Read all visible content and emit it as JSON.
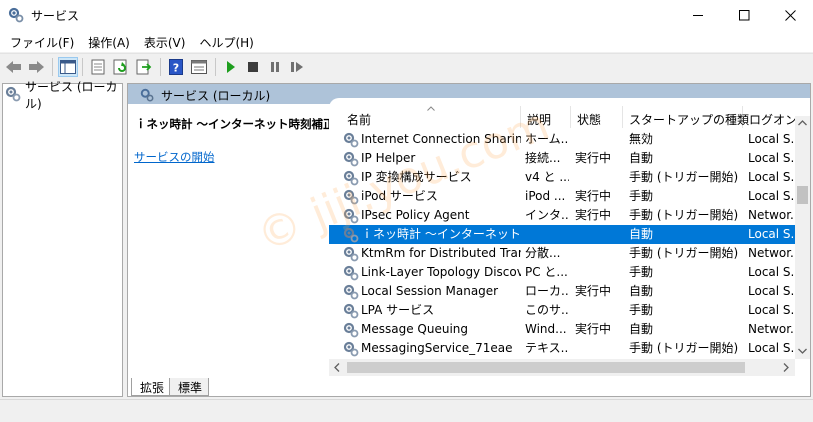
{
  "window": {
    "title": "サービス",
    "icon": "gear-icon"
  },
  "menu": {
    "items": [
      {
        "label": "ファイル(F)"
      },
      {
        "label": "操作(A)"
      },
      {
        "label": "表示(V)"
      },
      {
        "label": "ヘルプ(H)"
      }
    ]
  },
  "toolbar": {
    "icons": [
      "back-icon",
      "forward-icon",
      "console-tree-icon",
      "properties-icon",
      "refresh-icon",
      "export-icon",
      "help-icon",
      "view-icon",
      "start-service-icon",
      "stop-service-icon",
      "pause-service-icon",
      "resume-service-icon"
    ],
    "colors": {
      "start": "#1e9e1e",
      "stop": "#3c3c3c",
      "help": "#2a56c6"
    }
  },
  "tree": {
    "root_label": "サービス (ローカル)"
  },
  "right_pane": {
    "header_title": "サービス (ローカル)",
    "selected_service_name": "ｉネッ時計 ～インターネット時刻補正～",
    "start_link": "サービスの開始"
  },
  "table": {
    "columns": {
      "name": "名前",
      "description": "説明",
      "status": "状態",
      "startup": "スタートアップの種類",
      "logon": "ログオン"
    },
    "rows": [
      {
        "name": "Internet Connection Sharin...",
        "desc": "ホーム...",
        "status": "",
        "startup": "無効",
        "logon": "Local S..."
      },
      {
        "name": "IP Helper",
        "desc": "接続...",
        "status": "実行中",
        "startup": "自動",
        "logon": "Local S..."
      },
      {
        "name": "IP 変換構成サービス",
        "desc": "v4 と ...",
        "status": "",
        "startup": "手動 (トリガー開始)",
        "logon": "Local S..."
      },
      {
        "name": "iPod サービス",
        "desc": "iPod ...",
        "status": "実行中",
        "startup": "手動",
        "logon": "Local S..."
      },
      {
        "name": "IPsec Policy Agent",
        "desc": "インタ...",
        "status": "実行中",
        "startup": "手動 (トリガー開始)",
        "logon": "Networ..."
      },
      {
        "name": "ｉネッ時計 ～インターネット時...",
        "desc": "",
        "status": "",
        "startup": "自動",
        "logon": "Local S..."
      },
      {
        "name": "KtmRm for Distributed Trans...",
        "desc": "分散...",
        "status": "",
        "startup": "手動 (トリガー開始)",
        "logon": "Networ..."
      },
      {
        "name": "Link-Layer Topology Discov...",
        "desc": "PC と...",
        "status": "",
        "startup": "手動",
        "logon": "Local S..."
      },
      {
        "name": "Local Session Manager",
        "desc": "ローカ...",
        "status": "実行中",
        "startup": "自動",
        "logon": "Local S..."
      },
      {
        "name": "LPA サービス",
        "desc": "このサ...",
        "status": "",
        "startup": "手動",
        "logon": "Local S..."
      },
      {
        "name": "Message Queuing",
        "desc": "Wind...",
        "status": "実行中",
        "startup": "自動",
        "logon": "Networ..."
      },
      {
        "name": "MessagingService_71eae",
        "desc": "テキス...",
        "status": "",
        "startup": "手動 (トリガー開始)",
        "logon": "Local S..."
      }
    ],
    "selected_index": 5,
    "selection_color": "#0078d7"
  },
  "tabs": [
    {
      "label": "拡張"
    },
    {
      "label": "標準"
    }
  ],
  "watermark": "© jiji.you.com"
}
